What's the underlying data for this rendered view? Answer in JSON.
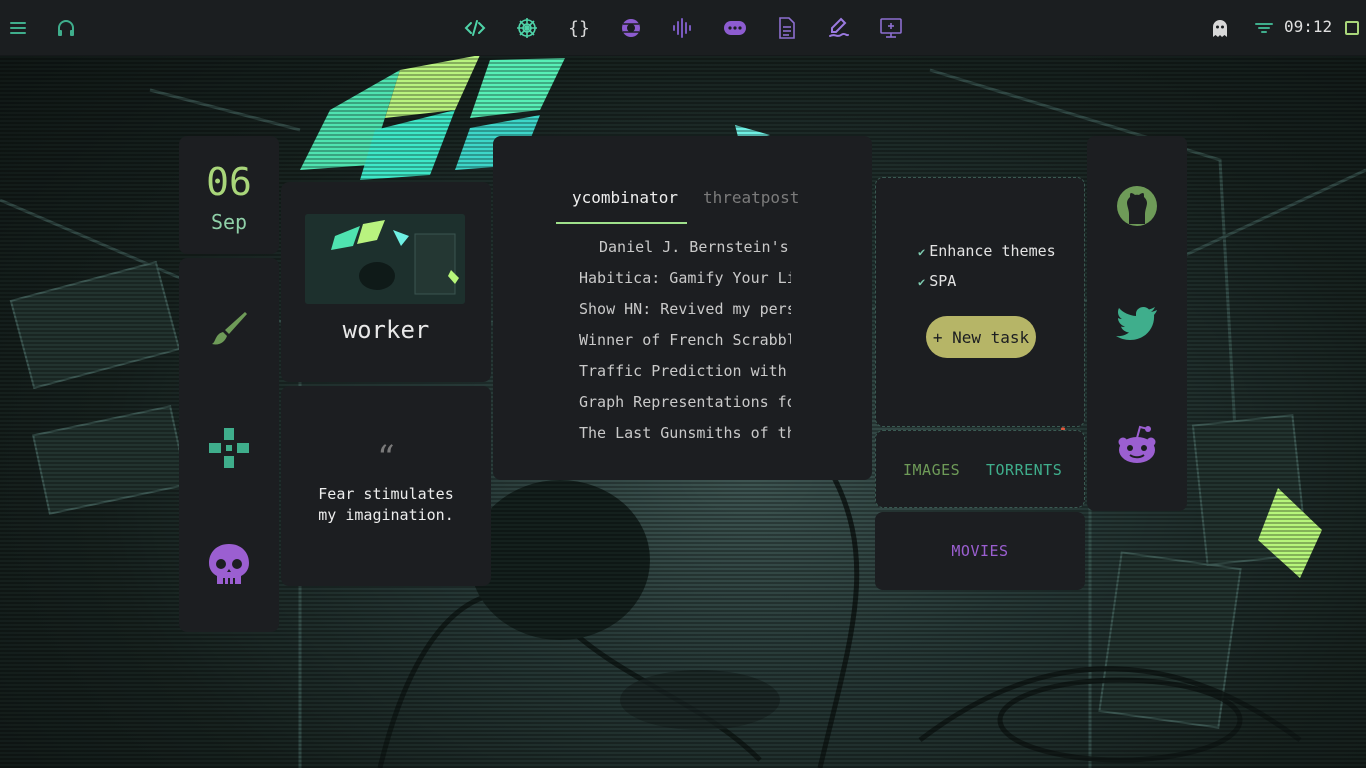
{
  "topbar": {
    "left_icons": [
      "menu-icon",
      "headphones-icon"
    ],
    "center_icons": [
      "code-icon",
      "spider-web-icon",
      "curly-braces-icon",
      "spider-icon",
      "waveform-icon",
      "chat-bubble-icon",
      "document-icon",
      "signature-icon",
      "monitor-icon"
    ],
    "right_icons": [
      "ghost-icon",
      "filter-icon",
      "square-icon"
    ],
    "clock": "09:12"
  },
  "date": {
    "day": "06",
    "month": "Sep"
  },
  "sidebar_icons": [
    "paintbrush-icon",
    "gamepad-icon",
    "skull-icon"
  ],
  "profile": {
    "name": "worker"
  },
  "quote": {
    "icon": "“",
    "text": "Fear stimulates my imagination."
  },
  "news": {
    "tabs": [
      {
        "label": "ycombinator",
        "active": true
      },
      {
        "label": "threatpost",
        "active": false
      }
    ],
    "items": [
      "Daniel J. Bernstein's",
      "Habitica: Gamify Your Life",
      "Show HN: Revived my person",
      "Winner of French Scrabble",
      "Traffic Prediction with Ad",
      "Graph Representations for",
      "The Last Gunsmiths of the"
    ]
  },
  "todo": {
    "items": [
      "Enhance themes",
      "SPA"
    ],
    "button": "+ New task"
  },
  "links": {
    "images": "IMAGES",
    "torrents": "TORRENTS",
    "movies": "MOVIES"
  },
  "social": [
    "github-icon",
    "twitter-icon",
    "reddit-icon"
  ],
  "colors": {
    "accent_green": "#a9d67a",
    "teal": "#3fae8c",
    "purple": "#9b6fd1",
    "button_yellow": "#b6b567",
    "panel_bg": "#1c1e21",
    "bar_bg": "#1b1e20"
  }
}
